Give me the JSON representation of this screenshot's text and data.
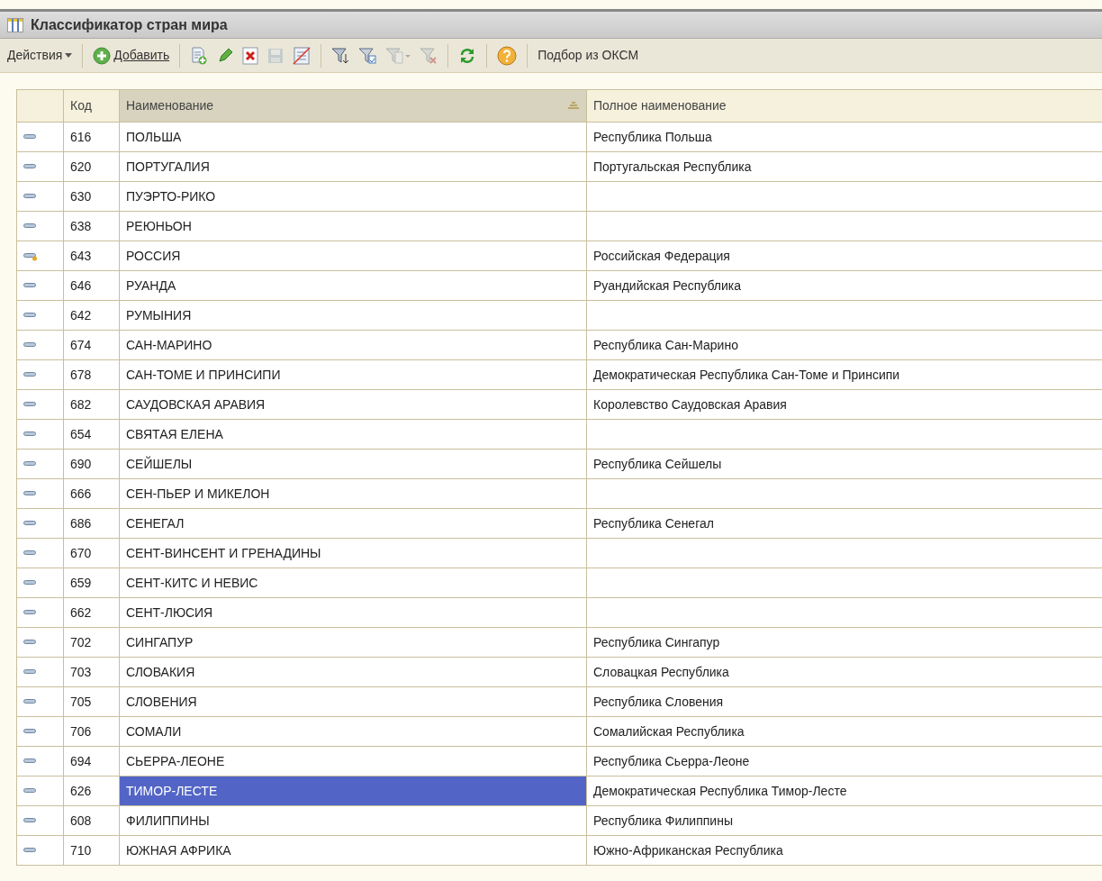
{
  "window": {
    "title": "Классификатор стран мира"
  },
  "toolbar": [
    {
      "kind": "menu",
      "label": "Действия",
      "disabled": false
    },
    {
      "kind": "sep"
    },
    {
      "kind": "add",
      "label": "Добавить",
      "disabled": false
    },
    {
      "kind": "sep"
    },
    {
      "kind": "copy",
      "disabled": false
    },
    {
      "kind": "edit",
      "disabled": false
    },
    {
      "kind": "delete",
      "disabled": false
    },
    {
      "kind": "save",
      "disabled": true
    },
    {
      "kind": "unmark",
      "disabled": false
    },
    {
      "kind": "sep"
    },
    {
      "kind": "filter-set",
      "disabled": false
    },
    {
      "kind": "filter-value",
      "disabled": false
    },
    {
      "kind": "filter-history",
      "disabled": true
    },
    {
      "kind": "filter-clear",
      "disabled": true
    },
    {
      "kind": "sep"
    },
    {
      "kind": "refresh",
      "disabled": false
    },
    {
      "kind": "sep"
    },
    {
      "kind": "help",
      "disabled": false
    },
    {
      "kind": "sep"
    },
    {
      "kind": "text",
      "label": "Подбор из ОКСМ",
      "disabled": false
    }
  ],
  "table": {
    "columns": [
      {
        "label": "Код",
        "sorted": false
      },
      {
        "label": "Наименование",
        "sorted": true
      },
      {
        "label": "Полное наименование",
        "sorted": false
      }
    ],
    "rows": [
      {
        "code": "616",
        "name": "ПОЛЬША",
        "full": "Республика Польша",
        "predefined": false,
        "selected": false
      },
      {
        "code": "620",
        "name": "ПОРТУГАЛИЯ",
        "full": "Португальская Республика",
        "predefined": false,
        "selected": false
      },
      {
        "code": "630",
        "name": "ПУЭРТО-РИКО",
        "predefined": false,
        "selected": false
      },
      {
        "code": "638",
        "name": "РЕЮНЬОН",
        "predefined": false,
        "selected": false
      },
      {
        "code": "643",
        "name": "РОССИЯ",
        "full": "Российская Федерация",
        "predefined": true,
        "selected": false
      },
      {
        "code": "646",
        "name": "РУАНДА",
        "full": "Руандийская Республика",
        "predefined": false,
        "selected": false
      },
      {
        "code": "642",
        "name": "РУМЫНИЯ",
        "predefined": false,
        "selected": false
      },
      {
        "code": "674",
        "name": "САН-МАРИНО",
        "full": "Республика Сан-Марино",
        "predefined": false,
        "selected": false
      },
      {
        "code": "678",
        "name": "САН-ТОМЕ И ПРИНСИПИ",
        "full": "Демократическая Республика Сан-Томе и Принсипи",
        "predefined": false,
        "selected": false
      },
      {
        "code": "682",
        "name": "САУДОВСКАЯ АРАВИЯ",
        "full": "Королевство Саудовская Аравия",
        "predefined": false,
        "selected": false
      },
      {
        "code": "654",
        "name": "СВЯТАЯ ЕЛЕНА",
        "predefined": false,
        "selected": false
      },
      {
        "code": "690",
        "name": "СЕЙШЕЛЫ",
        "full": "Республика Сейшелы",
        "predefined": false,
        "selected": false
      },
      {
        "code": "666",
        "name": "СЕН-ПЬЕР И МИКЕЛОН",
        "predefined": false,
        "selected": false
      },
      {
        "code": "686",
        "name": "СЕНЕГАЛ",
        "full": "Республика Сенегал",
        "predefined": false,
        "selected": false
      },
      {
        "code": "670",
        "name": "СЕНТ-ВИНСЕНТ И ГРЕНАДИНЫ",
        "predefined": false,
        "selected": false
      },
      {
        "code": "659",
        "name": "СЕНТ-КИТС И НЕВИС",
        "predefined": false,
        "selected": false
      },
      {
        "code": "662",
        "name": "СЕНТ-ЛЮСИЯ",
        "predefined": false,
        "selected": false
      },
      {
        "code": "702",
        "name": "СИНГАПУР",
        "full": "Республика Сингапур",
        "predefined": false,
        "selected": false
      },
      {
        "code": "703",
        "name": "СЛОВАКИЯ",
        "full": "Словацкая Республика",
        "predefined": false,
        "selected": false
      },
      {
        "code": "705",
        "name": "СЛОВЕНИЯ",
        "full": "Республика Словения",
        "predefined": false,
        "selected": false
      },
      {
        "code": "706",
        "name": "СОМАЛИ",
        "full": "Сомалийская Республика",
        "predefined": false,
        "selected": false
      },
      {
        "code": "694",
        "name": "СЬЕРРА-ЛЕОНЕ",
        "full": "Республика Сьерра-Леоне",
        "predefined": false,
        "selected": false
      },
      {
        "code": "626",
        "name": "ТИМОР-ЛЕСТЕ",
        "full": "Демократическая Республика Тимор-Лесте",
        "predefined": false,
        "selected": true
      },
      {
        "code": "608",
        "name": "ФИЛИППИНЫ",
        "full": "Республика Филиппины",
        "predefined": false,
        "selected": false
      },
      {
        "code": "710",
        "name": "ЮЖНАЯ АФРИКА",
        "full": "Южно-Африканская Республика",
        "predefined": false,
        "selected": false
      }
    ]
  }
}
